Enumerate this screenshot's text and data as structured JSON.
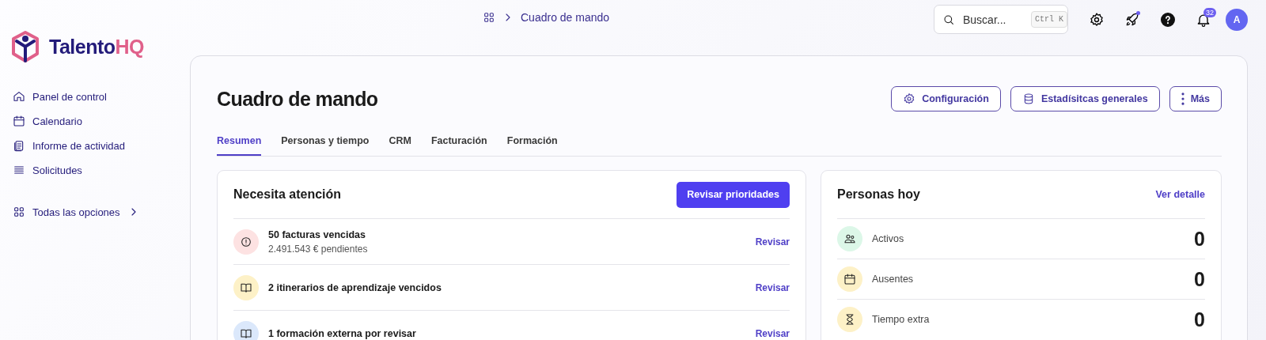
{
  "brand": {
    "name_main": "Talento",
    "name_accent": "HQ"
  },
  "sidebar": {
    "items": [
      {
        "label": "Panel de control",
        "kind": "home"
      },
      {
        "label": "Calendario",
        "kind": "calendar"
      },
      {
        "label": "Informe de actividad",
        "kind": "report"
      },
      {
        "label": "Solicitudes",
        "kind": "list"
      }
    ],
    "all_options": "Todas las opciones"
  },
  "breadcrumb": {
    "current": "Cuadro de mando"
  },
  "search": {
    "placeholder": "Buscar...",
    "shortcut": "Ctrl K"
  },
  "notifications": {
    "count": "32"
  },
  "rocket_has_dot": true,
  "avatar": {
    "initial": "A"
  },
  "page": {
    "title": "Cuadro de mando",
    "actions": [
      {
        "label": "Configuración",
        "kind": "gear"
      },
      {
        "label": "Estadísitcas generales",
        "kind": "database"
      },
      {
        "label": "Más",
        "kind": "dots"
      }
    ],
    "tabs": [
      {
        "label": "Resumen",
        "selected": true
      },
      {
        "label": "Personas y tiempo",
        "selected": false
      },
      {
        "label": "CRM",
        "selected": false
      },
      {
        "label": "Facturación",
        "selected": false
      },
      {
        "label": "Formación",
        "selected": false
      }
    ]
  },
  "attention": {
    "title": "Necesita atención",
    "button": "Revisar prioridades",
    "items": [
      {
        "title": "50 facturas vencidas",
        "subtitle": "2.491.543 € pendientes",
        "kind": "alert",
        "color": "#fde2e2",
        "action": "Revisar"
      },
      {
        "title": "2 itinerarios de aprendizaje vencidos",
        "kind": "book",
        "color": "#fdf1c7",
        "action": "Revisar"
      },
      {
        "title": "1 formación externa por revisar",
        "kind": "book",
        "color": "#dbe8fb",
        "action": "Revisar"
      }
    ]
  },
  "people_today": {
    "title": "Personas hoy",
    "link": "Ver detalle",
    "rows": [
      {
        "label": "Activos",
        "value": "0",
        "kind": "people",
        "color": "#dcf7e8"
      },
      {
        "label": "Ausentes",
        "value": "0",
        "kind": "calendar",
        "color": "#fdf1c7"
      },
      {
        "label": "Tiempo extra",
        "value": "0",
        "kind": "hourglass",
        "color": "#fdf1c7"
      }
    ]
  }
}
